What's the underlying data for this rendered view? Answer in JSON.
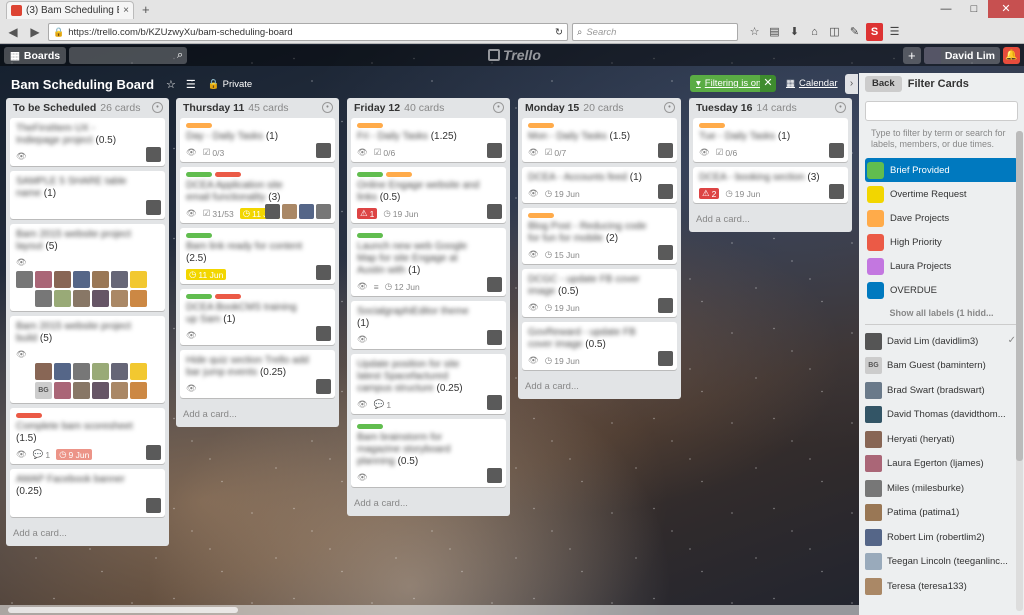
{
  "browser": {
    "tab_title": "(3) Bam Scheduling Board | ...",
    "tab_close": "×",
    "new_tab": "+",
    "url": "https://trello.com/b/KZUzwyXu/bam-scheduling-board",
    "search_placeholder": "Search"
  },
  "header": {
    "boards_label": "Boards",
    "logo_text": "Trello",
    "user_name": "David Lim"
  },
  "board": {
    "title": "Bam Scheduling Board",
    "visibility": "Private",
    "filter_label": "Filtering is on.",
    "calendar_label": "Calendar"
  },
  "colors": {
    "green": "#61bd4f",
    "yellow": "#f2d600",
    "orange": "#ffab4a",
    "red": "#eb5a46",
    "purple": "#c377e0",
    "blue": "#0079bf"
  },
  "lists": [
    {
      "name": "To be Scheduled",
      "count": "26 cards",
      "add": "Add a card...",
      "cards": [
        {
          "title": "TheFirstItem UX - Indiepage project",
          "score": "(0.5)",
          "labels": [],
          "badges": [
            "eye"
          ],
          "members": 1
        },
        {
          "title": "SAMPLE 5 SHARE table name",
          "score": "(1)",
          "labels": [],
          "badges": [],
          "members": 1
        },
        {
          "title": "Bam 2015 website project layout",
          "score": "(5)",
          "labels": [],
          "badges": [
            "eye"
          ],
          "grid": true
        },
        {
          "title": "Bam 2015 website project build",
          "score": "(5)",
          "labels": [],
          "badges": [
            "eye"
          ],
          "grid": true
        },
        {
          "title": "Complete bam scoresheet",
          "score": "(1.5)",
          "labels": [
            "red"
          ],
          "badges": [
            "eye"
          ],
          "comments": "1",
          "due": "9 Jun",
          "due_color": "red",
          "members": 1
        },
        {
          "title": "AMAP Facebook banner",
          "score": "(0.25)",
          "labels": [],
          "badges": [],
          "members": 1
        }
      ]
    },
    {
      "name": "Thursday 11",
      "count": "45 cards",
      "add": "Add a card...",
      "cards": [
        {
          "title": "Day - Daily Tasks",
          "score": "(1)",
          "labels": [
            "orange"
          ],
          "badges": [
            "eye"
          ],
          "check": "0/3",
          "members": 1
        },
        {
          "title": "DCEA Application site email functionality",
          "score": "(3)",
          "labels": [
            "green",
            "red"
          ],
          "badges": [
            "eye"
          ],
          "check": "31/53",
          "due": "11 Jun",
          "due_color": "yellow",
          "members": 4
        },
        {
          "title": "Bam link ready for content",
          "score": "(2.5)",
          "labels": [
            "green"
          ],
          "badges": [],
          "due": "11 Jun",
          "due_color": "yellow",
          "members": 1
        },
        {
          "title": "DCEA BookCMS training up Sam",
          "score": "(1)",
          "labels": [
            "green",
            "red"
          ],
          "badges": [
            "eye"
          ],
          "members": 1
        },
        {
          "title": "Hide quiz section Trello add bar jump events",
          "score": "(0.25)",
          "labels": [],
          "badges": [
            "eye"
          ],
          "members": 1
        }
      ]
    },
    {
      "name": "Friday 12",
      "count": "40 cards",
      "add": "Add a card...",
      "cards": [
        {
          "title": "Fri - Daily Tasks",
          "score": "(1.25)",
          "labels": [
            "orange"
          ],
          "badges": [
            "eye"
          ],
          "check": "0/6",
          "members": 1
        },
        {
          "title": "Online Engage website and links",
          "score": "(0.5)",
          "labels": [
            "green",
            "orange"
          ],
          "badges": [],
          "alert": "1",
          "due": "19 Jun",
          "members": 1
        },
        {
          "title": "Launch new web Google Map for site Engage at Austin with",
          "score": "(1)",
          "labels": [
            "green"
          ],
          "badges": [
            "eye",
            "desc"
          ],
          "due": "12 Jun",
          "members": 1
        },
        {
          "title": "SocialgraphiEditor theme",
          "score": "(1)",
          "labels": [],
          "badges": [
            "eye"
          ],
          "members": 1
        },
        {
          "title": "Update position for site latest Spacefactured campus structure",
          "score": "(0.25)",
          "labels": [],
          "badges": [
            "eye"
          ],
          "comments": "1",
          "members": 1
        },
        {
          "title": "Bam brainstorm for magazine storyboard planning",
          "score": "(0.5)",
          "labels": [
            "green"
          ],
          "badges": [
            "eye"
          ],
          "members": 1
        }
      ]
    },
    {
      "name": "Monday 15",
      "count": "20 cards",
      "add": "Add a card...",
      "cards": [
        {
          "title": "Mon - Daily Tasks",
          "score": "(1.5)",
          "labels": [
            "orange"
          ],
          "badges": [
            "eye"
          ],
          "check": "0/7",
          "members": 1
        },
        {
          "title": "DCEA - Accounts feed",
          "score": "(1)",
          "labels": [],
          "badges": [
            "eye"
          ],
          "due": "19 Jun",
          "members": 1
        },
        {
          "title": "Blog Post - Reducing code for fun for mobile",
          "score": "(2)",
          "labels": [
            "orange"
          ],
          "badges": [
            "eye"
          ],
          "due": "15 Jun",
          "members": 1
        },
        {
          "title": "DCGC - update FB cover image",
          "score": "(0.5)",
          "labels": [],
          "badges": [
            "eye"
          ],
          "due": "19 Jun",
          "members": 1
        },
        {
          "title": "GovReward - update FB cover image",
          "score": "(0.5)",
          "labels": [],
          "badges": [
            "eye"
          ],
          "due": "19 Jun",
          "members": 1
        }
      ]
    },
    {
      "name": "Tuesday 16",
      "count": "14 cards",
      "add": "Add a card...",
      "cards": [
        {
          "title": "Tue - Daily Tasks",
          "score": "(1)",
          "labels": [
            "orange"
          ],
          "badges": [
            "eye"
          ],
          "check": "0/6",
          "members": 1
        },
        {
          "title": "DCEA - booking section",
          "score": "(3)",
          "labels": [],
          "badges": [],
          "alert": "2",
          "due": "19 Jun",
          "members": 1
        }
      ]
    }
  ],
  "panel": {
    "back": "Back",
    "title": "Filter Cards",
    "hint": "Type to filter by term or search for labels, members, or due times.",
    "labels": [
      {
        "name": "Brief Provided",
        "color": "#61bd4f",
        "active": true
      },
      {
        "name": "Overtime Request",
        "color": "#f2d600",
        "active": false
      },
      {
        "name": "Dave Projects",
        "color": "#ffab4a",
        "active": false
      },
      {
        "name": "High Priority",
        "color": "#eb5a46",
        "active": false
      },
      {
        "name": "Laura Projects",
        "color": "#c377e0",
        "active": false
      },
      {
        "name": "OVERDUE",
        "color": "#0079bf",
        "active": false
      }
    ],
    "show_all": "Show all labels (1 hidd...",
    "members": [
      {
        "name": "David Lim (davidlim3)",
        "checked": true
      },
      {
        "name": "Bam Guest (bamintern)",
        "initials": "BG"
      },
      {
        "name": "Brad Swart (bradswart)"
      },
      {
        "name": "David Thomas (davidthom..."
      },
      {
        "name": "Heryati (heryati)"
      },
      {
        "name": "Laura Egerton (ljames)"
      },
      {
        "name": "Miles (milesburke)"
      },
      {
        "name": "Patima (patima1)"
      },
      {
        "name": "Robert Lim (robertlim2)"
      },
      {
        "name": "Teegan Lincoln (teeganlinc..."
      },
      {
        "name": "Teresa (teresa133)"
      }
    ]
  }
}
